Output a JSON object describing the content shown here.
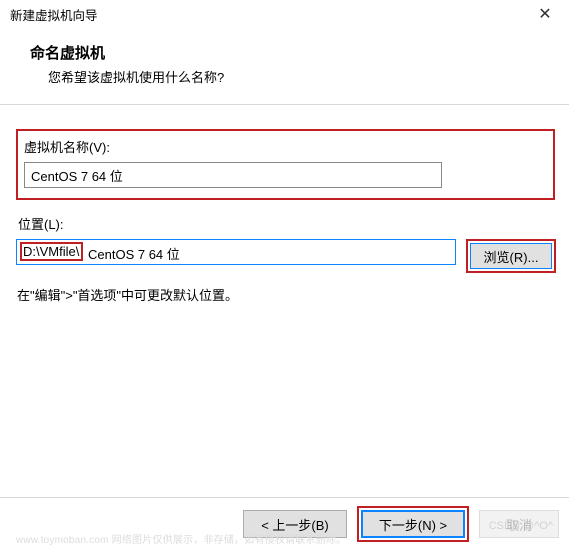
{
  "window": {
    "title": "新建虚拟机向导"
  },
  "header": {
    "heading": "命名虚拟机",
    "subtitle": "您希望该虚拟机使用什么名称?"
  },
  "fields": {
    "name_label": "虚拟机名称(V):",
    "name_value": "CentOS 7 64 位",
    "location_label": "位置(L):",
    "location_prefix": "D:\\VMfile\\",
    "location_rest": "CentOS 7 64 位",
    "browse_label": "浏览(R)..."
  },
  "hint": "在\"编辑\">\"首选项\"中可更改默认位置。",
  "footer": {
    "back": "< 上一步(B)",
    "next": "下一步(N) >",
    "cancel": "取消"
  },
  "watermarks": {
    "left": "www.toymoban.com 网络图片仅供展示，非存储，如有侵权请联系删除。",
    "right": "CSDN @^O^"
  }
}
